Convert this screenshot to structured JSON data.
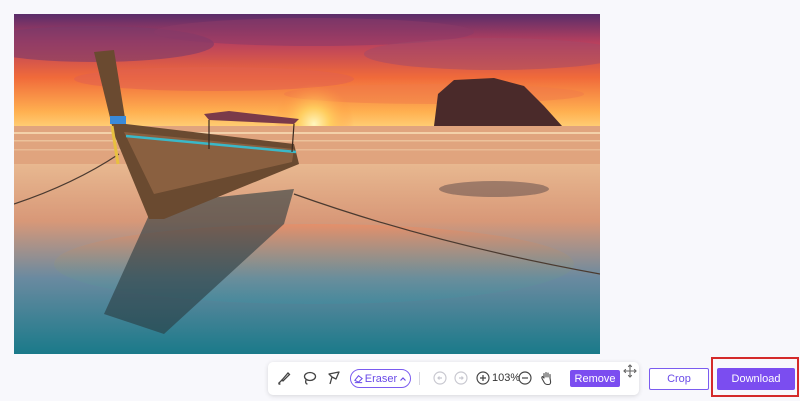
{
  "canvas": {
    "image_subject": "longtail boat on beach at sunset"
  },
  "toolbar": {
    "tools": {
      "brush_icon": "brush-icon",
      "lasso_icon": "lasso-icon",
      "polygon_lasso_icon": "polygon-lasso-icon"
    },
    "eraser_label": "Eraser",
    "zoom_level": "103%",
    "remove_label": "Remove"
  },
  "actions": {
    "crop_label": "Crop",
    "download_label": "Download"
  },
  "colors": {
    "accent": "#7b4df0",
    "highlight_border": "#d42a2a",
    "background": "#f8f8fc"
  }
}
